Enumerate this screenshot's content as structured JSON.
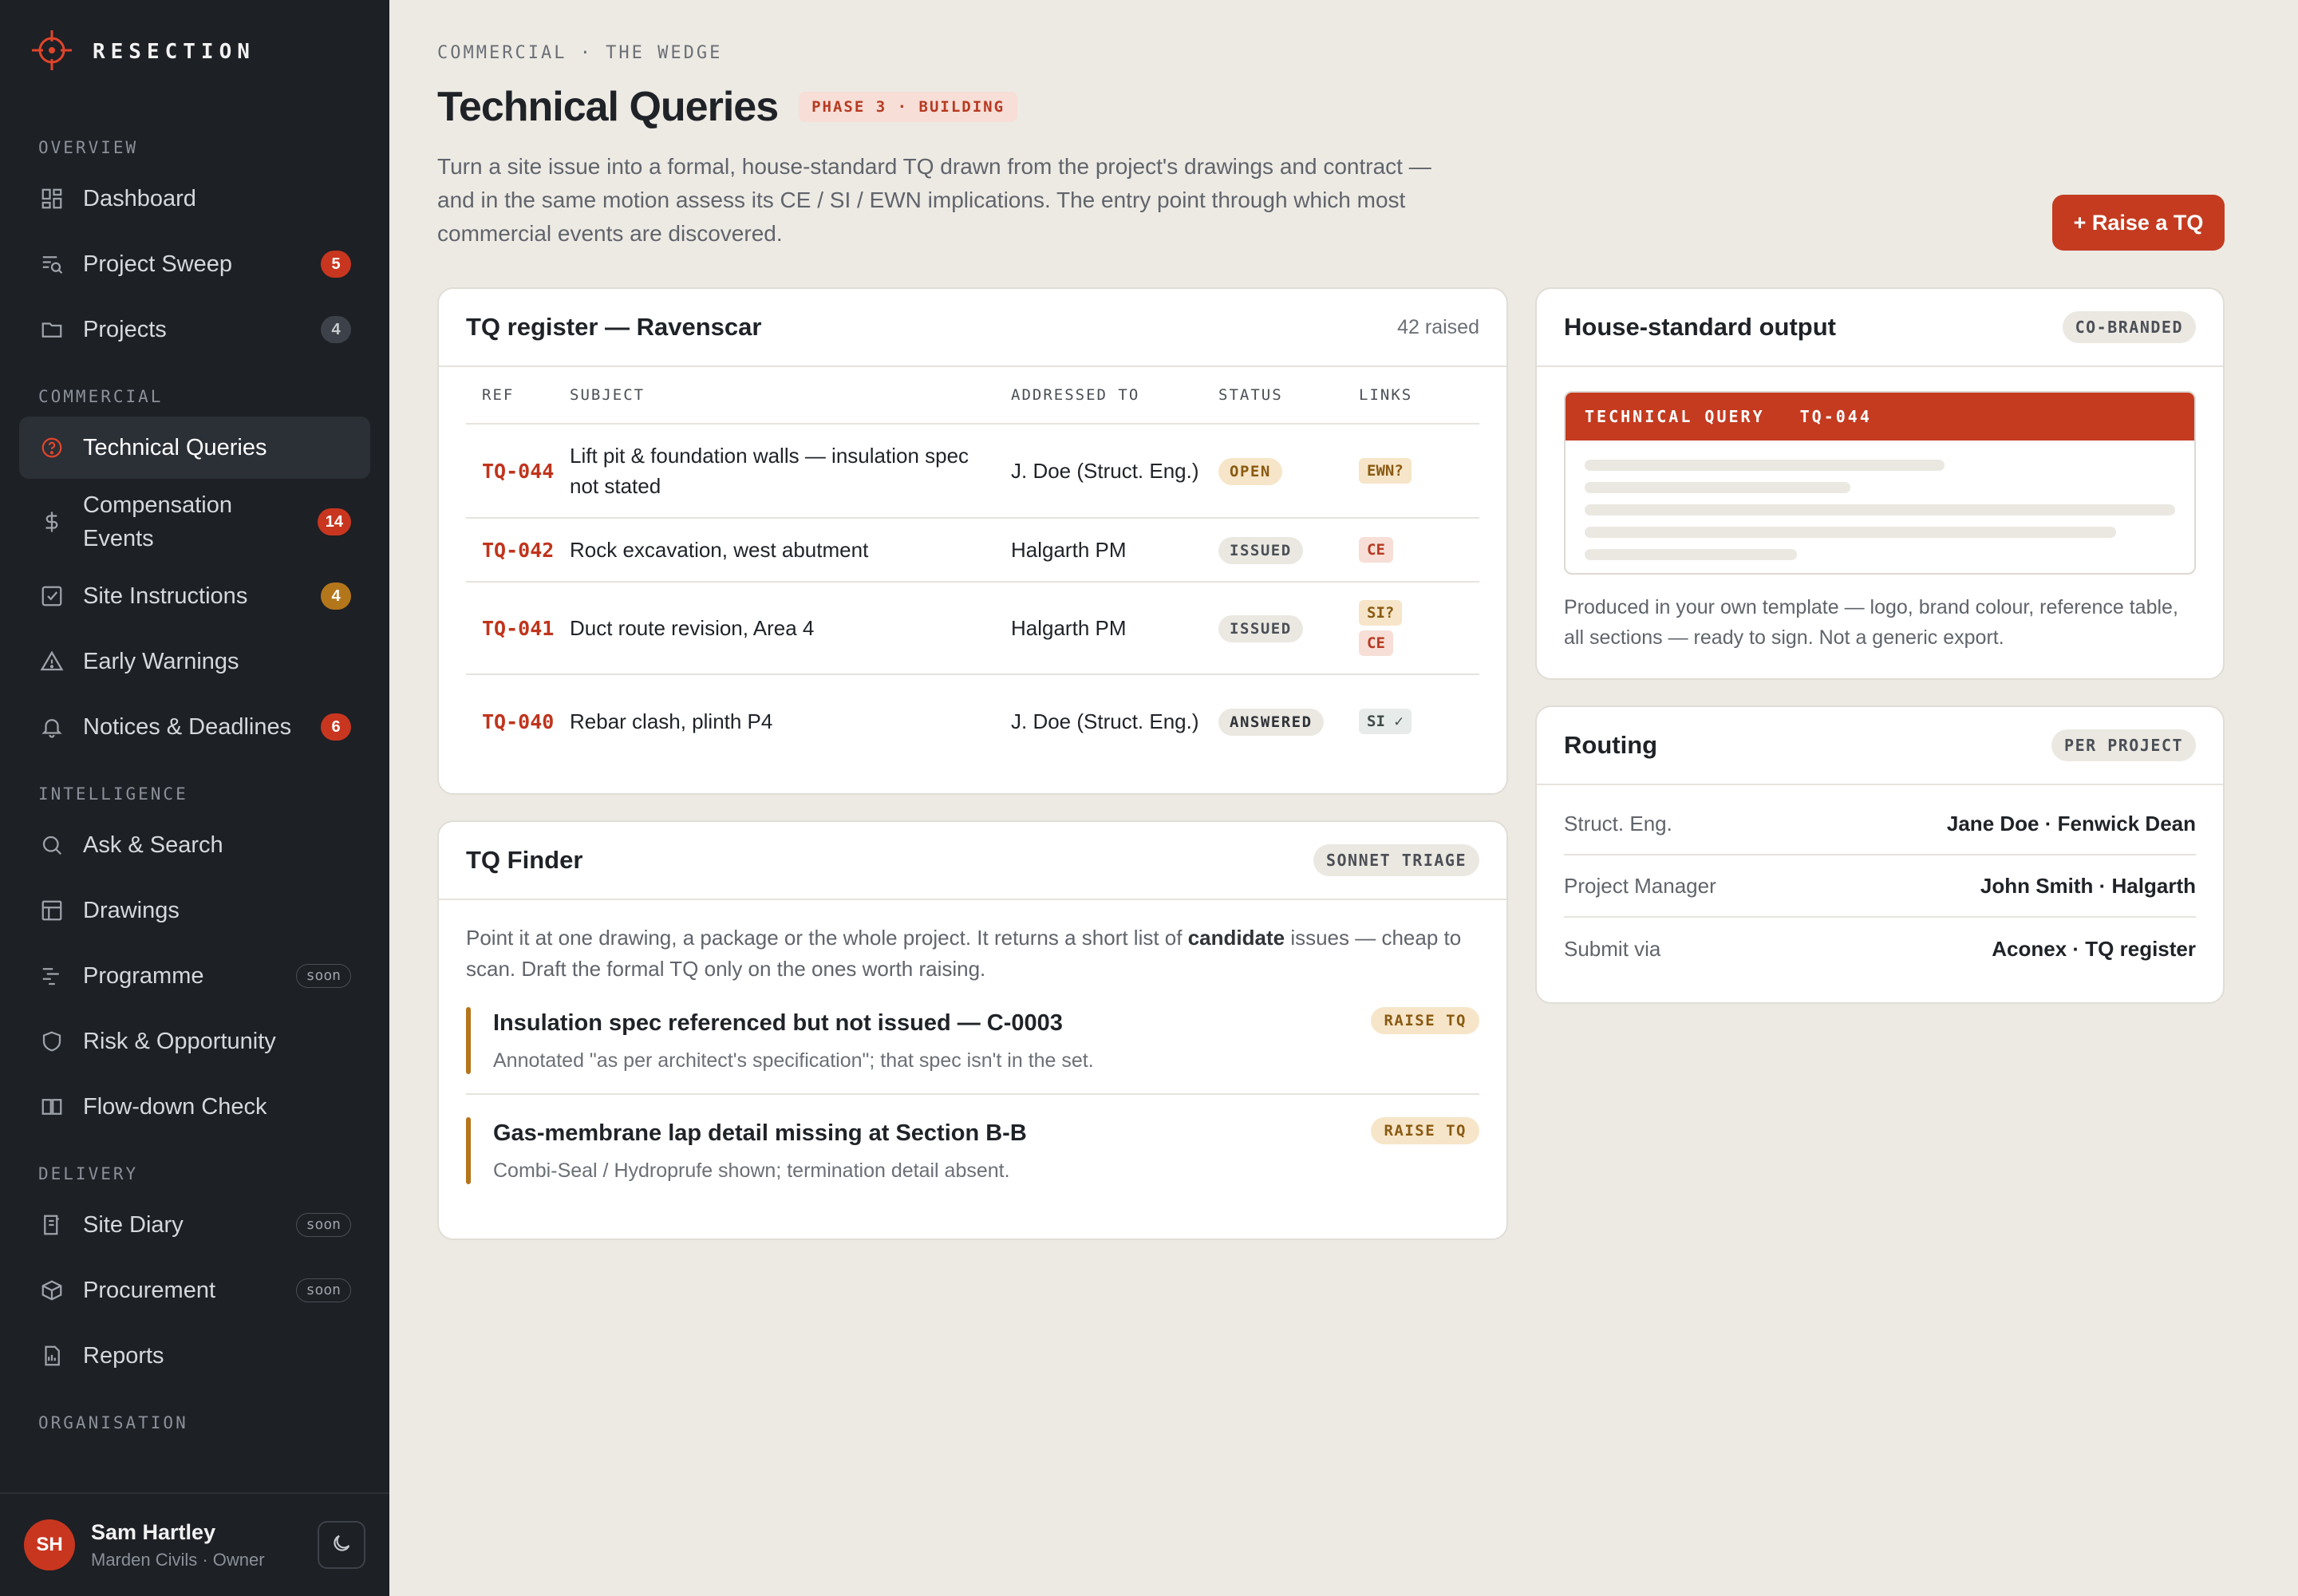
{
  "app": {
    "brand": "RESECTION"
  },
  "sidebar": {
    "sections": {
      "overview": "OVERVIEW",
      "commercial": "COMMERCIAL",
      "intelligence": "INTELLIGENCE",
      "delivery": "DELIVERY",
      "organisation": "ORGANISATION"
    },
    "items": {
      "dashboard": {
        "label": "Dashboard",
        "icon": "grid-icon"
      },
      "sweep": {
        "label": "Project Sweep",
        "badge": "5",
        "icon": "sweep-icon"
      },
      "projects": {
        "label": "Projects",
        "badge": "4",
        "icon": "folder-icon"
      },
      "tq": {
        "label": "Technical Queries",
        "icon": "question-circle-icon",
        "active": true
      },
      "ce": {
        "label": "Compensation Events",
        "badge": "14",
        "icon": "dollar-icon"
      },
      "si": {
        "label": "Site Instructions",
        "badge": "4",
        "icon": "checkbox-icon"
      },
      "ew": {
        "label": "Early Warnings",
        "icon": "warning-icon"
      },
      "notices": {
        "label": "Notices & Deadlines",
        "badge": "6",
        "icon": "bell-icon"
      },
      "ask": {
        "label": "Ask & Search",
        "icon": "search-icon"
      },
      "drawings": {
        "label": "Drawings",
        "icon": "layout-icon"
      },
      "programme": {
        "label": "Programme",
        "badge": "soon",
        "icon": "gantt-icon"
      },
      "risk": {
        "label": "Risk & Opportunity",
        "icon": "shield-icon"
      },
      "flowdown": {
        "label": "Flow-down Check",
        "icon": "columns-icon"
      },
      "diary": {
        "label": "Site Diary",
        "badge": "soon",
        "icon": "book-icon"
      },
      "procurement": {
        "label": "Procurement",
        "badge": "soon",
        "icon": "box-icon"
      },
      "reports": {
        "label": "Reports",
        "icon": "report-icon"
      }
    },
    "user": {
      "initials": "SH",
      "name": "Sam Hartley",
      "org": "Marden Civils · Owner"
    }
  },
  "header": {
    "breadcrumb": "COMMERCIAL · THE WEDGE",
    "title": "Technical Queries",
    "phase": "PHASE 3 · BUILDING",
    "description": "Turn a site issue into a formal, house-standard TQ drawn from the project's drawings and contract — and in the same motion assess its CE / SI / EWN implications. The entry point through which most commercial events are discovered.",
    "raise_button": "+ Raise a TQ"
  },
  "register": {
    "title": "TQ register — Ravenscar",
    "count": "42 raised",
    "columns": [
      "REF",
      "SUBJECT",
      "ADDRESSED TO",
      "STATUS",
      "LINKS"
    ],
    "rows": [
      {
        "ref": "TQ-044",
        "subject": "Lift pit & foundation walls — insulation spec not stated",
        "to": "J. Doe (Struct. Eng.)",
        "status": "OPEN",
        "links": [
          "EWN?"
        ]
      },
      {
        "ref": "TQ-042",
        "subject": "Rock excavation, west abutment",
        "to": "Halgarth PM",
        "status": "ISSUED",
        "links": [
          "CE"
        ]
      },
      {
        "ref": "TQ-041",
        "subject": "Duct route revision, Area 4",
        "to": "Halgarth PM",
        "status": "ISSUED",
        "links": [
          "SI?",
          "CE"
        ]
      },
      {
        "ref": "TQ-040",
        "subject": "Rebar clash, plinth P4",
        "to": "J. Doe (Struct. Eng.)",
        "status": "ANSWERED",
        "links": [
          "SI ✓"
        ]
      }
    ]
  },
  "finder": {
    "title": "TQ Finder",
    "tag": "SONNET TRIAGE",
    "intro_a": "Point it at one drawing, a package or the whole project. It returns a short list of ",
    "intro_bold": "candidate",
    "intro_b": " issues — cheap to scan. Draft the formal TQ only on the ones worth raising.",
    "items": [
      {
        "title": "Insulation spec referenced but not issued — C-0003",
        "desc": "Annotated \"as per architect's specification\"; that spec isn't in the set.",
        "action": "RAISE TQ"
      },
      {
        "title": "Gas-membrane lap detail missing at Section B-B",
        "desc": "Combi-Seal / Hydroprufe shown; termination detail absent.",
        "action": "RAISE TQ"
      }
    ]
  },
  "house": {
    "title": "House-standard output",
    "tag": "CO-BRANDED",
    "preview_label": "TECHNICAL QUERY",
    "preview_ref": "TQ-044",
    "desc": "Produced in your own template — logo, brand colour, reference table, all sections — ready to sign. Not a generic export."
  },
  "routing": {
    "title": "Routing",
    "tag": "PER PROJECT",
    "rows": [
      {
        "key": "Struct. Eng.",
        "value": "Jane Doe · Fenwick Dean"
      },
      {
        "key": "Project Manager",
        "value": "John Smith · Halgarth"
      },
      {
        "key": "Submit via",
        "value": "Aconex · TQ register"
      }
    ]
  },
  "colors": {
    "accent": "#c43b20",
    "sidebar_bg": "#1d2025",
    "page_bg": "#edeae4",
    "amber": "#b4761b"
  }
}
